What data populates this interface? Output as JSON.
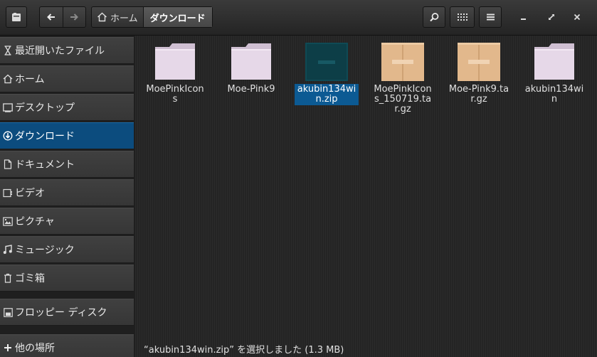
{
  "window": {
    "breadcrumbs": [
      {
        "label": "ホーム",
        "icon": "home-icon"
      },
      {
        "label": "ダウンロード"
      }
    ]
  },
  "header": {
    "icons": [
      "app-icon",
      "back-arrow-icon",
      "forward-arrow-icon",
      "search-icon",
      "grid-view-icon",
      "menu-icon",
      "minimize-icon",
      "maximize-icon",
      "close-icon"
    ]
  },
  "sidebar": {
    "items": [
      {
        "label": "最近開いたファイル",
        "icon": "recent-icon"
      },
      {
        "label": "ホーム",
        "icon": "home-icon"
      },
      {
        "label": "デスクトップ",
        "icon": "desktop-icon"
      },
      {
        "label": "ダウンロード",
        "icon": "download-icon",
        "active": true
      },
      {
        "label": "ドキュメント",
        "icon": "document-icon"
      },
      {
        "label": "ビデオ",
        "icon": "video-icon"
      },
      {
        "label": "ピクチャ",
        "icon": "picture-icon"
      },
      {
        "label": "ミュージック",
        "icon": "music-icon"
      },
      {
        "label": "ゴミ箱",
        "icon": "trash-icon"
      },
      {
        "label": "フロッピー ディスク",
        "icon": "floppy-icon"
      },
      {
        "label": "他の場所",
        "icon": "plus-icon"
      }
    ]
  },
  "files": [
    {
      "name": "MoePinkIcons",
      "type": "folder"
    },
    {
      "name": "Moe-Pink9",
      "type": "folder"
    },
    {
      "name": "akubin134win.zip",
      "type": "zip",
      "selected": true
    },
    {
      "name": "MoePinkIcons_150719.tar.gz",
      "type": "archive"
    },
    {
      "name": "Moe-Pink9.tar.gz",
      "type": "archive"
    },
    {
      "name": "akubin134win",
      "type": "folder"
    }
  ],
  "status": {
    "text": "“akubin134win.zip” を選択しました (1.3 MB)"
  },
  "colors": {
    "accent": "#0c4c7e",
    "folder": "#e6d8e8",
    "archive": "#e2b88c",
    "zip": "#0d3e47"
  }
}
